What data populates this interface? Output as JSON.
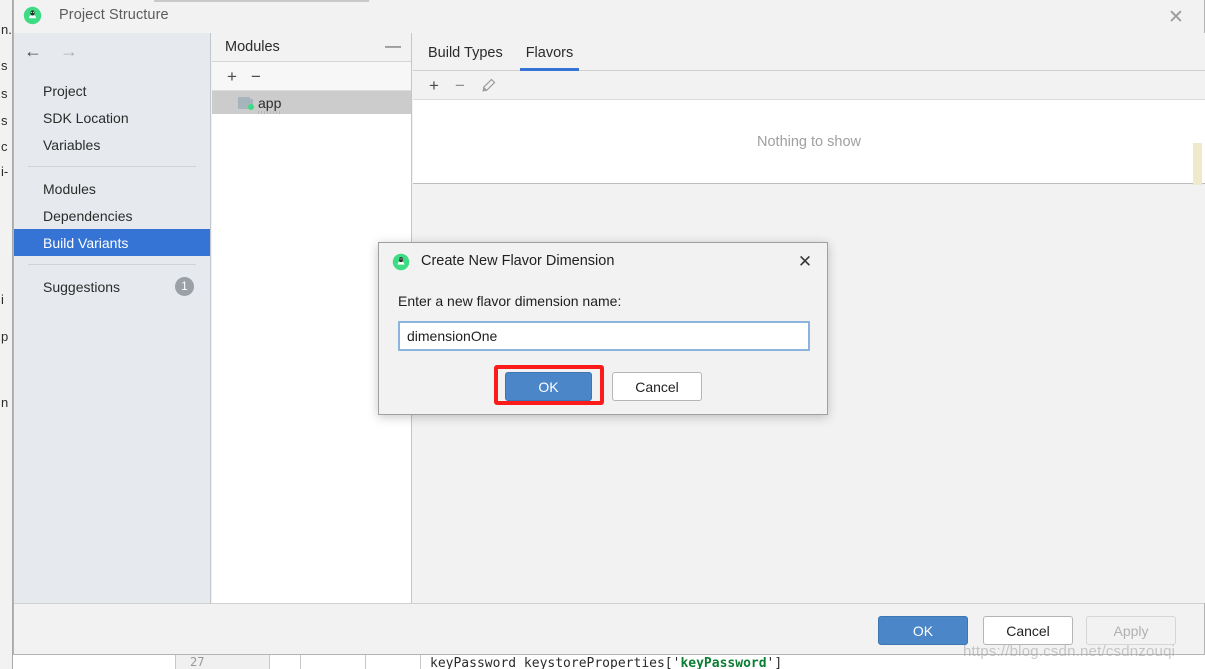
{
  "window": {
    "title": "Project Structure",
    "icon": "android-studio-icon",
    "close_label": "✕"
  },
  "sidebar": {
    "back_arrow": "←",
    "forward_arrow": "→",
    "items": [
      {
        "label": "Project",
        "selected": false
      },
      {
        "label": "SDK Location",
        "selected": false
      },
      {
        "label": "Variables",
        "selected": false
      },
      {
        "label": "Modules",
        "selected": false
      },
      {
        "label": "Dependencies",
        "selected": false
      },
      {
        "label": "Build Variants",
        "selected": true
      },
      {
        "label": "Suggestions",
        "selected": false,
        "badge": "1"
      }
    ]
  },
  "modules_panel": {
    "header": "Modules",
    "collapse_label": "—",
    "toolbar": {
      "add": "+",
      "remove": "−"
    },
    "rows": [
      {
        "label": "app",
        "icon": "folder-icon",
        "selected": true
      }
    ]
  },
  "content": {
    "tabs": [
      {
        "label": "Build Types",
        "active": false
      },
      {
        "label": "Flavors",
        "active": true
      }
    ],
    "toolbar": {
      "add": "+",
      "remove": "−",
      "edit_icon": "pencil-icon"
    },
    "empty_text": "Nothing to show"
  },
  "footer": {
    "ok": "OK",
    "cancel": "Cancel",
    "apply": "Apply"
  },
  "modal": {
    "title": "Create New Flavor Dimension",
    "icon": "android-studio-icon",
    "close_label": "✕",
    "label": "Enter a new flavor dimension name:",
    "input_value": "dimensionOne",
    "input_placeholder": "",
    "ok": "OK",
    "cancel": "Cancel"
  },
  "background_ide": {
    "left_fragments": [
      "n.",
      "s",
      "s",
      "s",
      "c",
      "i-",
      "i",
      "p",
      "n"
    ],
    "line_number": "27",
    "code_line_prefix": "keyPassword  keystoreProperties['",
    "code_line_key": "keyPassword",
    "code_line_suffix": "']"
  },
  "watermark": {
    "text": "https://blog.csdn.net/csdnzouqi"
  },
  "colors": {
    "accent": "#3574d4",
    "primary_button": "#4a86c8",
    "selection": "#3574d4",
    "highlight_box": "#fc1b1b",
    "android_green": "#3ddc84",
    "marker_yellow": "#efeacc"
  }
}
